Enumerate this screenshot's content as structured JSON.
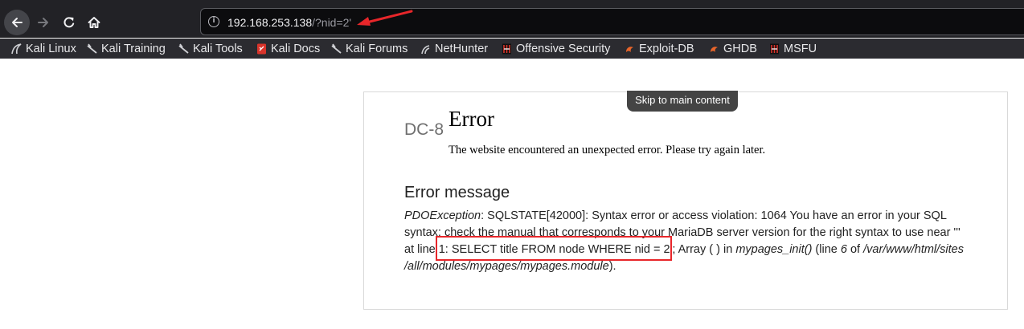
{
  "browser": {
    "url_host": "192.168.253.138",
    "url_path": "/?nid=2'",
    "bookmarks": [
      {
        "label": "Kali Linux",
        "icon": "kali-dragon-icon"
      },
      {
        "label": "Kali Training",
        "icon": "kali-dragon-icon"
      },
      {
        "label": "Kali Tools",
        "icon": "kali-dragon-icon"
      },
      {
        "label": "Kali Docs",
        "icon": "kali-docs-icon"
      },
      {
        "label": "Kali Forums",
        "icon": "kali-dragon-icon"
      },
      {
        "label": "NetHunter",
        "icon": "nethunter-icon"
      },
      {
        "label": "Offensive Security",
        "icon": "offsec-icon"
      },
      {
        "label": "Exploit-DB",
        "icon": "exploitdb-icon"
      },
      {
        "label": "GHDB",
        "icon": "exploitdb-icon"
      },
      {
        "label": "MSFU",
        "icon": "offsec-icon"
      }
    ],
    "colors": {
      "toolbar": "#222226",
      "bookmarks_bar": "#2b2b30",
      "annotation": "#e8262a"
    }
  },
  "page": {
    "skip_link": "Skip to main content",
    "site_name": "DC-8",
    "error_title": "Error",
    "error_subtitle": "The website encountered an unexpected error. Please try again later.",
    "message_heading": "Error message",
    "message": {
      "line1_exception": "PDOException",
      "line1_rest": ": SQLSTATE[42000]: Syntax error or access violation: 1064 You have an error in your SQL",
      "line2": "syntax; check the manual that corresponds to your MariaDB server version for the right syntax to use near '''",
      "line3_prefix": "at line ",
      "line3_query": "1: SELECT title FROM node WHERE nid = 2'",
      "line3_mid": "; Array ( ) in ",
      "line3_function": "mypages_init()",
      "line3_mid2": " (line ",
      "line3_lineno": "6",
      "line3_of": " of ",
      "line3_path": "/var/www/html/sites",
      "line4_path": "/all/modules/mypages/mypages.module",
      "line4_end": ")."
    }
  }
}
